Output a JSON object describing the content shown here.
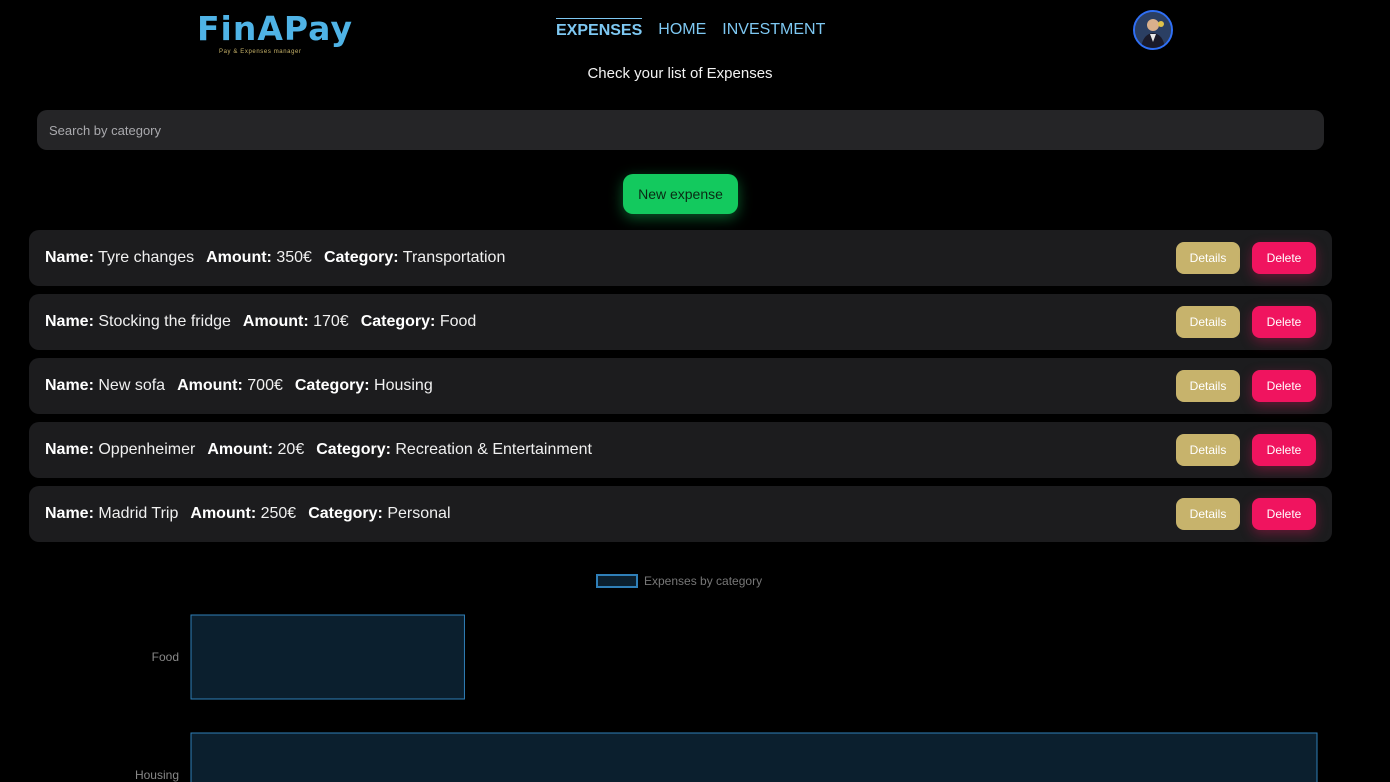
{
  "header": {
    "logo_text": "FinAPay",
    "logo_tagline": "Pay & Expenses manager",
    "nav": [
      {
        "label": "EXPENSES",
        "active": true
      },
      {
        "label": "HOME",
        "active": false
      },
      {
        "label": "INVESTMENT",
        "active": false
      }
    ]
  },
  "subtitle": "Check your list of Expenses",
  "search": {
    "placeholder": "Search by category",
    "value": ""
  },
  "new_expense_label": "New expense",
  "field_labels": {
    "name": "Name:",
    "amount": "Amount:",
    "category": "Category:"
  },
  "buttons": {
    "details": "Details",
    "delete": "Delete"
  },
  "expenses": [
    {
      "name": "Tyre changes",
      "amount": "350€",
      "category": "Transportation"
    },
    {
      "name": "Stocking the fridge",
      "amount": "170€",
      "category": "Food"
    },
    {
      "name": "New sofa",
      "amount": "700€",
      "category": "Housing"
    },
    {
      "name": "Oppenheimer",
      "amount": "20€",
      "category": "Recreation & Entertainment"
    },
    {
      "name": "Madrid Trip",
      "amount": "250€",
      "category": "Personal"
    }
  ],
  "colors": {
    "accent": "#7ec8f2",
    "new_button": "#13c95e",
    "details_button": "#c7b36c",
    "delete_button": "#f0145f",
    "bar_fill": "#0b1f2e",
    "bar_stroke": "#2f7fb8"
  },
  "chart_data": {
    "type": "bar",
    "orientation": "horizontal",
    "legend": "Expenses by category",
    "legend_position": "top",
    "categories": [
      "Food",
      "Housing"
    ],
    "series": [
      {
        "name": "Expenses by category",
        "values": [
          170,
          700
        ]
      }
    ],
    "xlim": [
      0,
      700
    ],
    "grid": false
  }
}
